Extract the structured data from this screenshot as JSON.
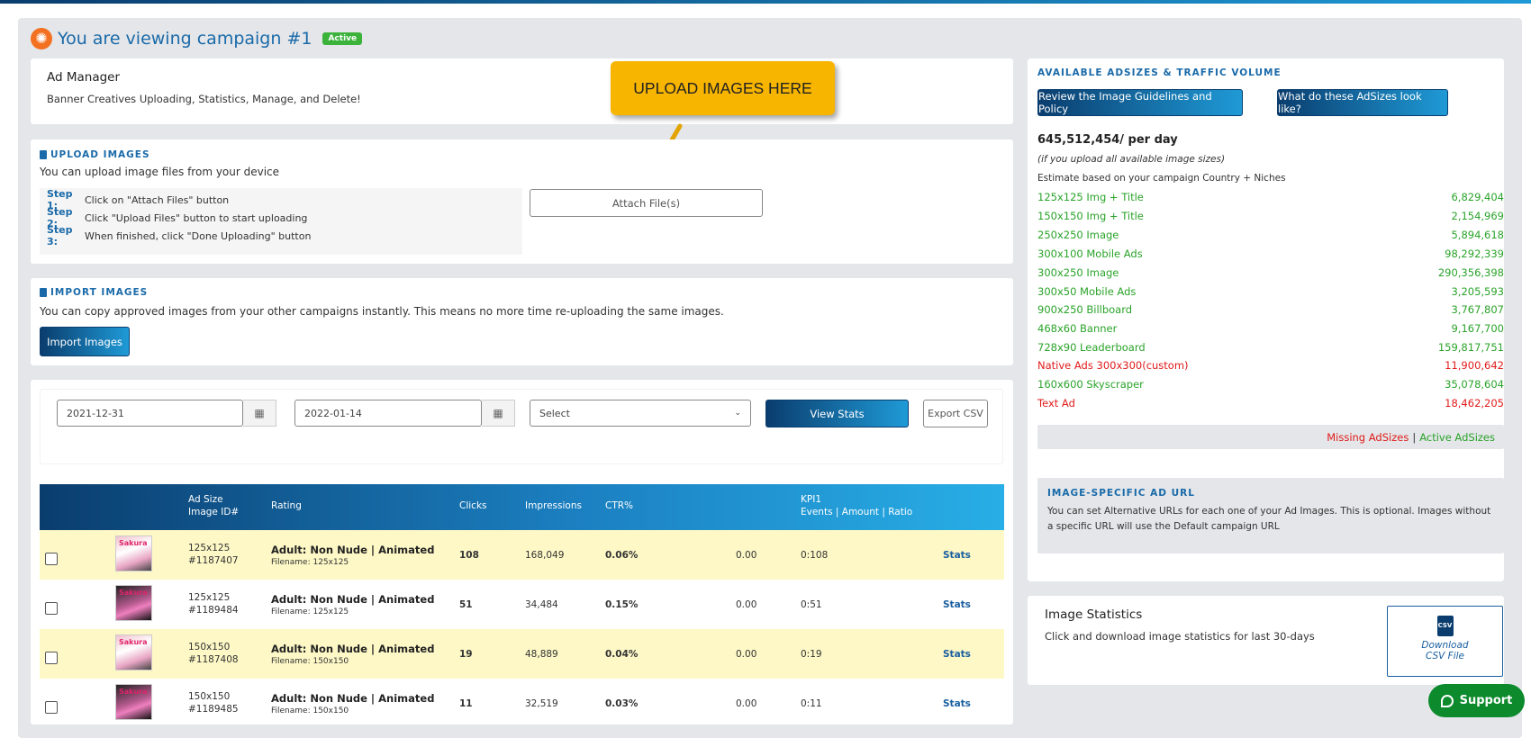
{
  "header": {
    "title": "You are viewing campaign #1",
    "badge": "Active",
    "logo_icon": "orange-slice-logo"
  },
  "ad_manager": {
    "title": "Ad Manager",
    "subtitle": "Banner Creatives Uploading, Statistics, Manage, and Delete!"
  },
  "callout": {
    "text": "UPLOAD IMAGES HERE"
  },
  "upload": {
    "title": "UPLOAD IMAGES",
    "desc": "You can upload image files from your device",
    "steps": [
      {
        "label": "Step 1:",
        "text": "Click on \"Attach Files\" button"
      },
      {
        "label": "Step 2:",
        "text": "Click \"Upload Files\" button to start uploading"
      },
      {
        "label": "Step 3:",
        "text": "When finished, click \"Done Uploading\" button"
      }
    ],
    "attach_label": "Attach File(s)"
  },
  "import": {
    "title": "IMPORT IMAGES",
    "desc": "You can copy approved images from your other campaigns instantly. This means no more time re-uploading the same images.",
    "button": "Import Images"
  },
  "filters": {
    "start_date": "2021-12-31",
    "end_date": "2022-01-14",
    "select_value": "Select",
    "view_stats": "View Stats",
    "export_csv": "Export CSV"
  },
  "table": {
    "headers": {
      "adsize": "Ad Size",
      "imageid": "Image ID#",
      "rating": "Rating",
      "clicks": "Clicks",
      "impressions": "Impressions",
      "ctr": "CTR%",
      "kpi": "KPI1",
      "kpi_sub": "Events | Amount | Ratio"
    },
    "rows": [
      {
        "size": "125x125",
        "id": "#1187407",
        "rating": "Adult: Non Nude | Animated",
        "filename": "Filename: 125x125",
        "clicks": "108",
        "impressions": "168,049",
        "ctr": "0.06%",
        "amount": "0.00",
        "kpi": "0:108",
        "stats": "Stats"
      },
      {
        "size": "125x125",
        "id": "#1189484",
        "rating": "Adult: Non Nude | Animated",
        "filename": "Filename: 125x125",
        "clicks": "51",
        "impressions": "34,484",
        "ctr": "0.15%",
        "amount": "0.00",
        "kpi": "0:51",
        "stats": "Stats"
      },
      {
        "size": "150x150",
        "id": "#1187408",
        "rating": "Adult: Non Nude | Animated",
        "filename": "Filename: 150x150",
        "clicks": "19",
        "impressions": "48,889",
        "ctr": "0.04%",
        "amount": "0.00",
        "kpi": "0:19",
        "stats": "Stats"
      },
      {
        "size": "150x150",
        "id": "#1189485",
        "rating": "Adult: Non Nude | Animated",
        "filename": "Filename: 150x150",
        "clicks": "11",
        "impressions": "32,519",
        "ctr": "0.03%",
        "amount": "0.00",
        "kpi": "0:11",
        "stats": "Stats"
      }
    ]
  },
  "adsizes": {
    "title": "AVAILABLE ADSIZES & TRAFFIC VOLUME",
    "guidelines_button": "Review the Image Guidelines and Policy",
    "look_button": "What do these AdSizes look like?",
    "total": "645,512,454/ per day",
    "note": "(if you upload all available image sizes)",
    "estimate": "Estimate based on your campaign Country + Niches",
    "items": [
      {
        "name": "125x125 Img + Title",
        "value": "6,829,404",
        "status": "active"
      },
      {
        "name": "150x150 Img + Title",
        "value": "2,154,969",
        "status": "active"
      },
      {
        "name": "250x250 Image",
        "value": "5,894,618",
        "status": "active"
      },
      {
        "name": "300x100 Mobile Ads",
        "value": "98,292,339",
        "status": "active"
      },
      {
        "name": "300x250 Image",
        "value": "290,356,398",
        "status": "active"
      },
      {
        "name": "300x50 Mobile Ads",
        "value": "3,205,593",
        "status": "active"
      },
      {
        "name": "900x250 Billboard",
        "value": "3,767,807",
        "status": "active"
      },
      {
        "name": "468x60 Banner",
        "value": "9,167,700",
        "status": "active"
      },
      {
        "name": "728x90 Leaderboard",
        "value": "159,817,751",
        "status": "active"
      },
      {
        "name": "Native Ads 300x300(custom)",
        "value": "11,900,642",
        "status": "missing"
      },
      {
        "name": "160x600 Skyscraper",
        "value": "35,078,604",
        "status": "active"
      },
      {
        "name": "Text Ad",
        "value": "18,462,205",
        "status": "missing"
      }
    ],
    "legend_missing": "Missing AdSizes",
    "legend_sep": "|",
    "legend_active": "Active AdSizes",
    "colors": {
      "active": "#2aa32a",
      "missing": "#e01b1b"
    }
  },
  "image_url": {
    "title": "IMAGE-SPECIFIC AD URL",
    "desc": "You can set Alternative URLs for each one of your Ad Images. This is optional. Images without a specific URL will use the Default campaign URL"
  },
  "image_stats": {
    "title": "Image Statistics",
    "desc": "Click and download image statistics for last 30-days",
    "download_line1": "Download",
    "download_line2": "CSV File",
    "file_icon": "csv-file-icon"
  },
  "support": {
    "label": "Support",
    "icon": "chat-bubble-icon"
  }
}
